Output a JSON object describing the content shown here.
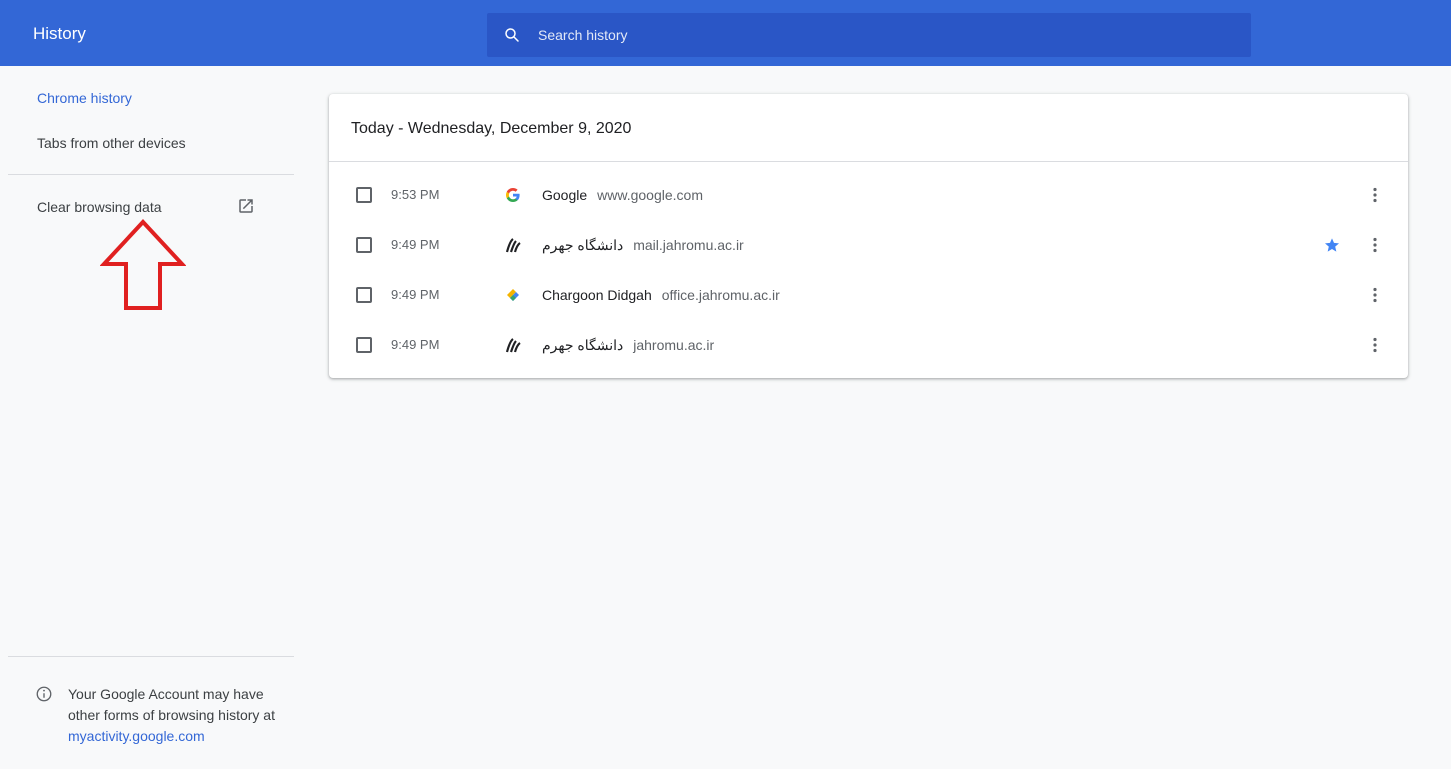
{
  "header": {
    "title": "History",
    "search_placeholder": "Search history"
  },
  "sidebar": {
    "items": [
      {
        "label": "Chrome history",
        "active": true
      },
      {
        "label": "Tabs from other devices",
        "active": false
      }
    ],
    "clear_label": "Clear browsing data",
    "info": {
      "text": "Your Google Account may have other forms of browsing history at",
      "link": "myactivity.google.com"
    }
  },
  "history": {
    "date_header": "Today - Wednesday, December 9, 2020",
    "entries": [
      {
        "time": "9:53 PM",
        "title": "Google",
        "domain": "www.google.com",
        "icon": "google-favicon",
        "starred": false
      },
      {
        "time": "9:49 PM",
        "title": "دانشگاه جهرم",
        "domain": "mail.jahromu.ac.ir",
        "icon": "jahrom-university-favicon",
        "starred": true
      },
      {
        "time": "9:49 PM",
        "title": "Chargoon Didgah",
        "domain": "office.jahromu.ac.ir",
        "icon": "chargoon-favicon",
        "starred": false
      },
      {
        "time": "9:49 PM",
        "title": "دانشگاه جهرم",
        "domain": "jahromu.ac.ir",
        "icon": "jahrom-university-favicon",
        "starred": false
      }
    ]
  },
  "colors": {
    "brand_blue": "#3367d6",
    "annotation_red": "#e02020",
    "star_blue": "#4285f4"
  }
}
